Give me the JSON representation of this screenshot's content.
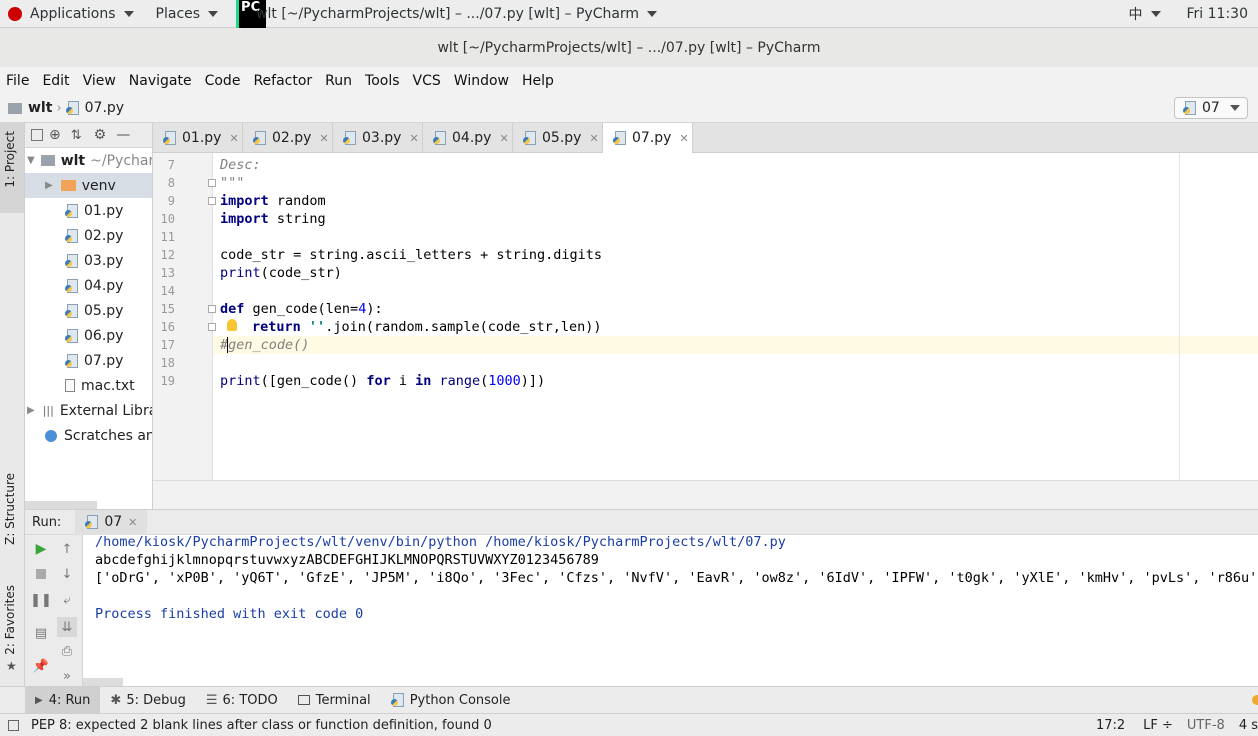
{
  "topbar": {
    "applications": "Applications",
    "places": "Places",
    "window_title": "wlt [~/PycharmProjects/wlt] – .../07.py [wlt] – PyCharm",
    "input_method": "中",
    "clock": "Fri 11:30"
  },
  "titlebar": {
    "title": "wlt [~/PycharmProjects/wlt] – .../07.py [wlt] – PyCharm"
  },
  "menu": [
    "File",
    "Edit",
    "View",
    "Navigate",
    "Code",
    "Refactor",
    "Run",
    "Tools",
    "VCS",
    "Window",
    "Help"
  ],
  "breadcrumb": {
    "project": "wlt",
    "file": "07.py"
  },
  "run_config": "07",
  "left_tools": {
    "project": "1: Project",
    "structure": "Z: Structure",
    "favorites": "2: Favorites"
  },
  "project_tree": {
    "root": "wlt",
    "root_path": "~/PycharmProjects/wlt",
    "items": [
      "venv",
      "01.py",
      "02.py",
      "03.py",
      "04.py",
      "05.py",
      "06.py",
      "07.py",
      "mac.txt"
    ],
    "external": "External Libraries",
    "scratches": "Scratches and Consoles"
  },
  "tabs": [
    "01.py",
    "02.py",
    "03.py",
    "04.py",
    "05.py",
    "07.py"
  ],
  "code": {
    "line_numbers": [
      "7",
      "8",
      "9",
      "10",
      "11",
      "12",
      "13",
      "14",
      "15",
      "16",
      "17",
      "18",
      "19"
    ],
    "l7": "Desc:",
    "l8": "\"\"\"",
    "kw_import": "import",
    "random": " random",
    "string": " string",
    "l12": "code_str = string.ascii_letters + string.digits",
    "print": "print",
    "l13_rest": "(code_str)",
    "kw_def": "def",
    "l15_a": " gen_code(len=",
    "num4": "4",
    "l15_b": "):",
    "kw_return": "return",
    "str_empty": "''",
    "l16_rest": ".join(random.sample(code_str,len))",
    "l17": "#gen_code()",
    "l19_a": "([gen_code() ",
    "kw_for": "for",
    "l19_b": " i ",
    "kw_in": "in",
    "range": "range",
    "l19_c": "(",
    "num1000": "1000",
    "l19_d": ")])"
  },
  "run": {
    "label": "Run:",
    "config": "07"
  },
  "console": {
    "cmd": "/home/kiosk/PycharmProjects/wlt/venv/bin/python /home/kiosk/PycharmProjects/wlt/07.py",
    "line2": "abcdefghijklmnopqrstuvwxyzABCDEFGHIJKLMNOPQRSTUVWXYZ0123456789",
    "line3": "['oDrG', 'xP0B', 'yQ6T', 'GfzE', 'JP5M', 'i8Qo', '3Fec', 'Cfzs', 'NvfV', 'EavR', 'ow8z', '6IdV', 'IPFW', 't0gk', 'yXlE', 'kmHv', 'pvLs', 'r86u', ",
    "exit": "Process finished with exit code 0"
  },
  "bottom_tabs": [
    "4: Run",
    "5: Debug",
    "6: TODO",
    "Terminal",
    "Python Console"
  ],
  "status": {
    "message": "PEP 8: expected 2 blank lines after class or function definition, found 0",
    "position": "17:2",
    "line_sep": "LF",
    "encoding": "UTF-8",
    "indent": "4 s"
  }
}
